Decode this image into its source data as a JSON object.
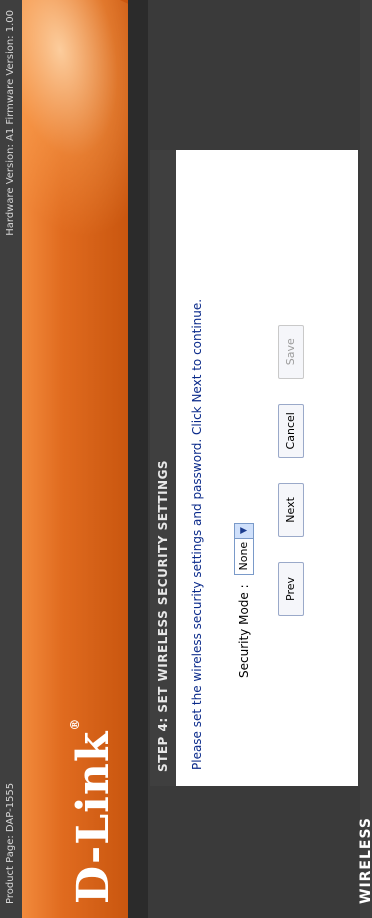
{
  "topbar": {
    "product": "Product Page: DAP-1555",
    "hw_fw": "Hardware Version: A1   Firmware Version: 1.00"
  },
  "banner": {
    "brand": "D-Link"
  },
  "wizard": {
    "title": "STEP 4: SET WIRELESS SECURITY SETTINGS",
    "instruction": "Please set the wireless security settings and password. Click Next to continue.",
    "security_mode_label": "Security Mode :",
    "security_mode_value": "None",
    "buttons": {
      "prev": "Prev",
      "next": "Next",
      "cancel": "Cancel",
      "save": "Save"
    }
  },
  "footer": {
    "label": "WIRELESS"
  },
  "colors": {
    "orange": "#e06b1f",
    "dark": "#3f3f3f",
    "link_blue": "#0a2a8a"
  }
}
